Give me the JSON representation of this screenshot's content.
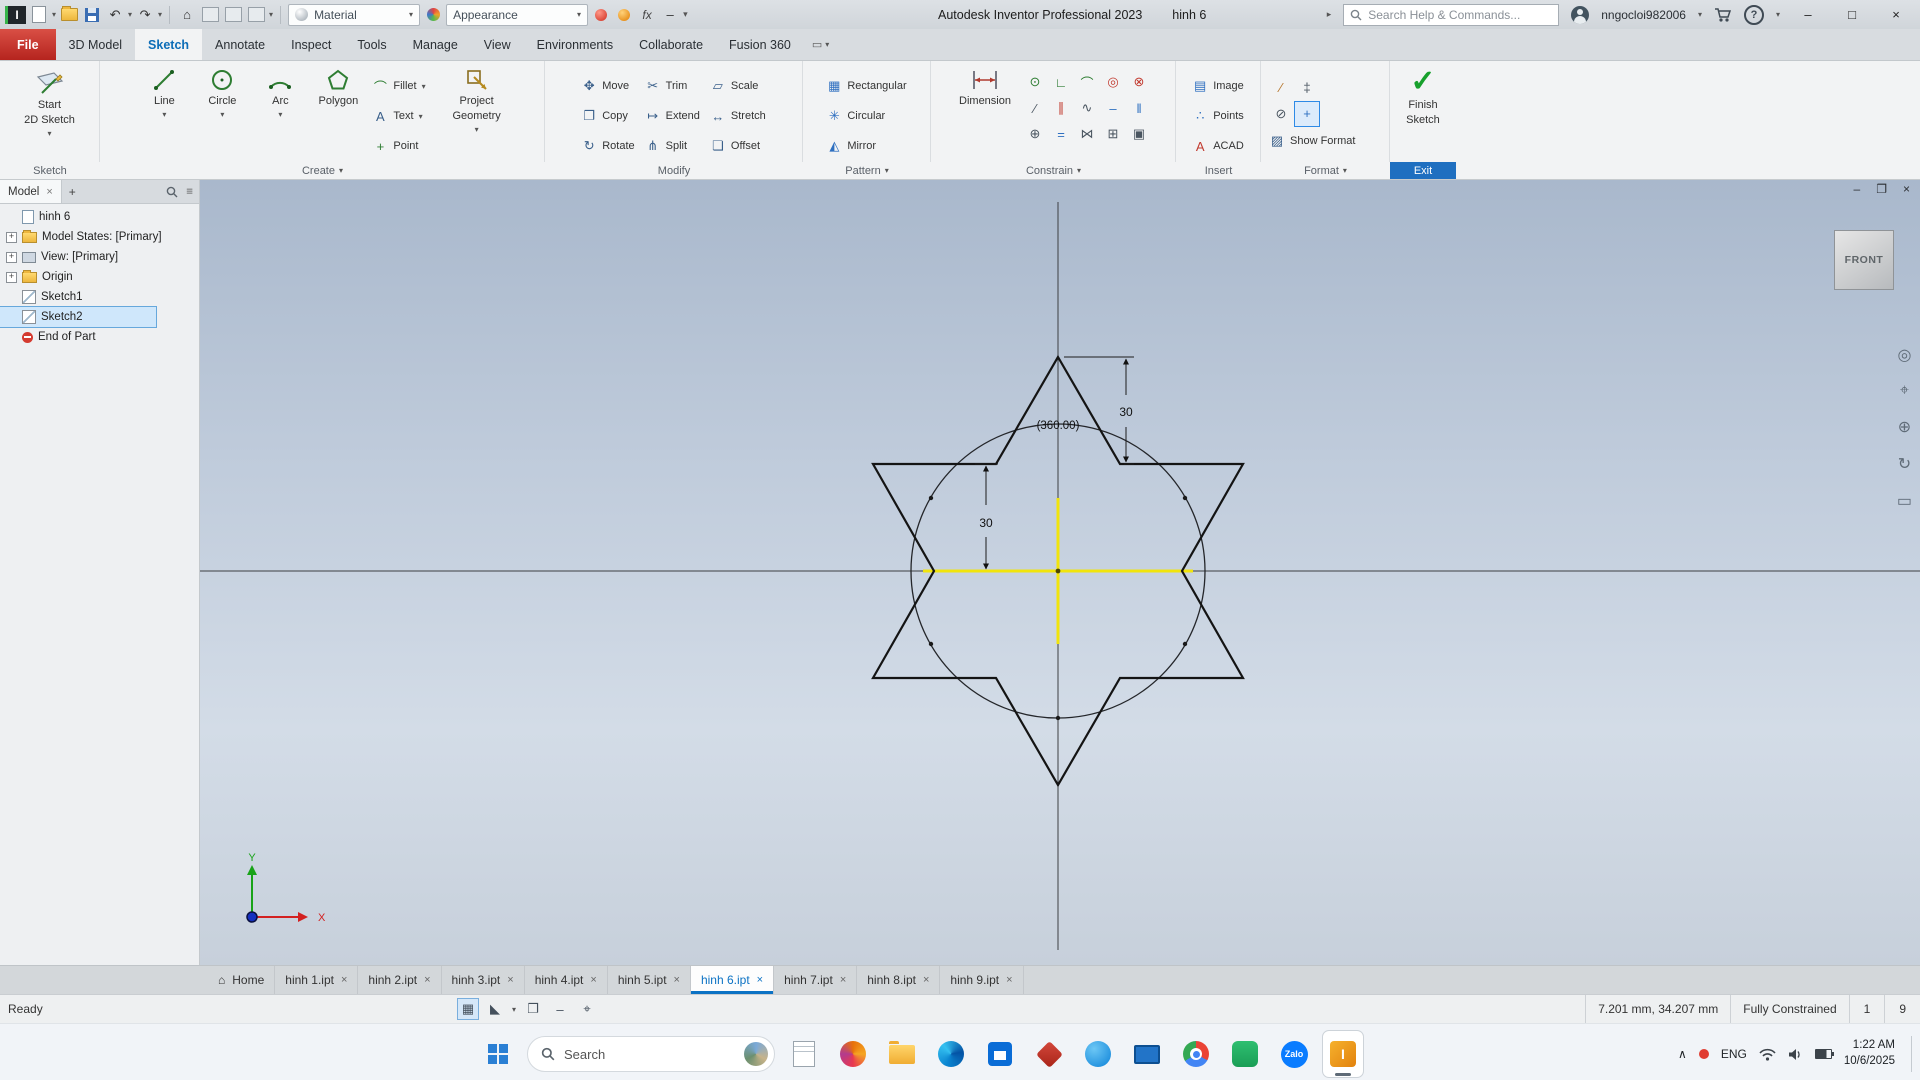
{
  "glyphs": {
    "caret": "▾",
    "caret_right": "▸",
    "close": "×",
    "minimize": "–",
    "maximize": "□",
    "restore": "❐",
    "home": "⌂",
    "undo": "↶",
    "redo": "↷",
    "hamburger": "≡",
    "plus": "+",
    "chevron_up": "∧",
    "help": "?",
    "check": "✓",
    "opts_box": "▭"
  },
  "icons": {
    "move": "✥",
    "copy": "❐",
    "rotate": "↻",
    "trim": "✂",
    "extend": "↦",
    "split": "⋔",
    "scale": "▱",
    "stretch": "↔",
    "offset": "❏",
    "fillet": "⌒",
    "text_tool": "A",
    "point": "+",
    "rectangular": "▦",
    "circular": "✳",
    "mirror": "◭",
    "image": "▤",
    "points": "∴",
    "acad": "A",
    "show_format": "▨",
    "construction": "∕",
    "centerline": "‡",
    "driven_dim": "⊘",
    "center_point": "+",
    "nav_wheel": "◎",
    "nav_pan": "⌖",
    "nav_zoom": "⊕",
    "nav_orbit": "↻",
    "nav_look": "▭",
    "status_grid": "▦",
    "status_slope": "◣",
    "status_plane": "❐",
    "status_dash": "–",
    "status_target": "⌖",
    "fx": "fx"
  },
  "titlebar": {
    "app_title": "Autodesk Inventor Professional 2023",
    "doc_name": "hinh 6",
    "material": "Material",
    "appearance": "Appearance",
    "search_placeholder": "Search Help & Commands...",
    "username": "nngocloi982006"
  },
  "ribbon_tabs": {
    "items": [
      {
        "label": "File"
      },
      {
        "label": "3D Model"
      },
      {
        "label": "Sketch"
      },
      {
        "label": "Annotate"
      },
      {
        "label": "Inspect"
      },
      {
        "label": "Tools"
      },
      {
        "label": "Manage"
      },
      {
        "label": "View"
      },
      {
        "label": "Environments"
      },
      {
        "label": "Collaborate"
      },
      {
        "label": "Fusion 360"
      }
    ]
  },
  "ribbon": {
    "sketch": {
      "label": "Sketch",
      "start_line1": "Start",
      "start_line2": "2D Sketch"
    },
    "create": {
      "label": "Create",
      "line": "Line",
      "circle": "Circle",
      "arc": "Arc",
      "polygon": "Polygon",
      "fillet": "Fillet",
      "text": "Text",
      "point": "Point",
      "project_line1": "Project",
      "project_line2": "Geometry"
    },
    "modify": {
      "label": "Modify",
      "items": [
        "Move",
        "Copy",
        "Rotate",
        "Trim",
        "Extend",
        "Split",
        "Scale",
        "Stretch",
        "Offset"
      ]
    },
    "pattern": {
      "label": "Pattern",
      "items": [
        "Rectangular",
        "Circular",
        "Mirror"
      ]
    },
    "constrain": {
      "label": "Constrain",
      "dimension": "Dimension"
    },
    "insert": {
      "label": "Insert",
      "image": "Image",
      "points": "Points",
      "acad": "ACAD"
    },
    "format": {
      "label": "Format",
      "show_format": "Show Format"
    },
    "exit": {
      "label": "Exit",
      "finish_line1": "Finish",
      "finish_line2": "Sketch"
    }
  },
  "constraints": [
    {
      "name": "coincident",
      "glyph": "⊙"
    },
    {
      "name": "perpendicular",
      "glyph": "∟"
    },
    {
      "name": "tangent",
      "glyph": "⌒"
    },
    {
      "name": "concentric",
      "glyph": "◎"
    },
    {
      "name": "lock",
      "glyph": "⊗"
    },
    {
      "name": "collinear",
      "glyph": "∕"
    },
    {
      "name": "parallel",
      "glyph": "∥"
    },
    {
      "name": "smooth",
      "glyph": "∿"
    },
    {
      "name": "horizontal",
      "glyph": "–"
    },
    {
      "name": "vertical",
      "glyph": "‖"
    },
    {
      "name": "fix",
      "glyph": "⊕"
    },
    {
      "name": "equal",
      "glyph": "="
    },
    {
      "name": "symmetric",
      "glyph": "⋈"
    },
    {
      "name": "auto-dimension",
      "glyph": "⊞"
    },
    {
      "name": "show-constraints",
      "glyph": "▣"
    }
  ],
  "browser": {
    "tab": "Model",
    "tree": [
      {
        "label": "hinh 6"
      },
      {
        "label": "Model States: [Primary]"
      },
      {
        "label": "View: [Primary]"
      },
      {
        "label": "Origin"
      },
      {
        "label": "Sketch1"
      },
      {
        "label": "Sketch2"
      },
      {
        "label": "End of Part"
      }
    ]
  },
  "canvas": {
    "viewcube": "FRONT",
    "dim_top": "30",
    "dim_left": "30",
    "angle": "(360.00)",
    "axis_x": "X",
    "axis_y": "Y"
  },
  "doctabs": [
    {
      "label": "Home"
    },
    {
      "label": "hinh 1.ipt"
    },
    {
      "label": "hinh 2.ipt"
    },
    {
      "label": "hinh 3.ipt"
    },
    {
      "label": "hinh 4.ipt"
    },
    {
      "label": "hinh 5.ipt"
    },
    {
      "label": "hinh 6.ipt"
    },
    {
      "label": "hinh 7.ipt"
    },
    {
      "label": "hinh 8.ipt"
    },
    {
      "label": "hinh 9.ipt"
    }
  ],
  "statusbar": {
    "ready": "Ready",
    "coords": "7.201 mm, 34.207 mm",
    "constraint_status": "Fully Constrained",
    "count1": "1",
    "count2": "9"
  },
  "taskbar": {
    "search": "Search",
    "zalo": "Zalo",
    "inventor_letter": "I",
    "lang": "ENG",
    "time": "1:22 AM",
    "date": "10/6/2025"
  }
}
